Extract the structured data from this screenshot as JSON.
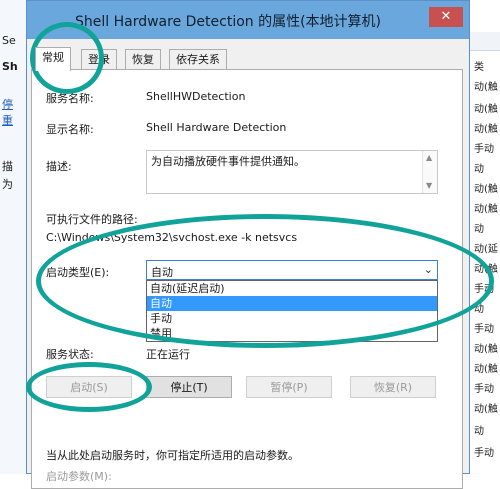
{
  "background": {
    "left_texts": [
      "Se",
      "Sh",
      "停",
      "重",
      "描",
      "为"
    ],
    "right_texts": [
      "动(触",
      "动(触",
      "动(触",
      "手动",
      "动",
      "动(触",
      "动(触",
      "动",
      "动(延",
      "动(触",
      "手动",
      "动",
      "手动",
      "动(触",
      "动(触",
      "手动",
      "动(触",
      "动",
      "手动"
    ],
    "right_header": "类"
  },
  "dialog": {
    "title": "Shell Hardware Detection 的属性(本地计算机)",
    "close_icon": "close-icon",
    "tabs": [
      "常规",
      "登录",
      "恢复",
      "依存关系"
    ],
    "active_tab": "常规",
    "service_name_label": "服务名称:",
    "service_name_value": "ShellHWDetection",
    "display_name_label": "显示名称:",
    "display_name_value": "Shell Hardware Detection",
    "description_label": "描述:",
    "description_value": "为自动播放硬件事件提供通知。",
    "exe_path_label": "可执行文件的路径:",
    "exe_path_value": "C:\\Windows\\System32\\svchost.exe -k netsvcs",
    "startup_type_label": "启动类型(E):",
    "startup_type_value": "自动",
    "startup_options": [
      "自动(延迟启动)",
      "自动",
      "手动",
      "禁用"
    ],
    "startup_selected_index": 1,
    "service_status_label": "服务状态:",
    "service_status_value": "正在运行",
    "buttons": {
      "start": "启动(S)",
      "stop": "停止(T)",
      "pause": "暂停(P)",
      "resume": "恢复(R)"
    },
    "hint_text": "当从此处启动服务时，你可指定所适用的启动参数。",
    "start_params_label": "启动参数(M):"
  },
  "colors": {
    "annotation_ring": "#11a39a",
    "titlebar": "#6aa7dc",
    "selection": "#3399ff"
  }
}
